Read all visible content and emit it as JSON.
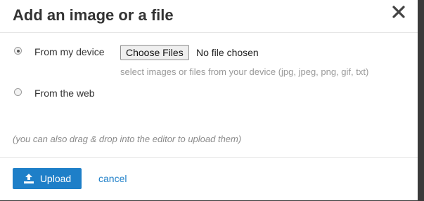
{
  "dialog": {
    "title": "Add an image or a file",
    "close_icon": "close-icon"
  },
  "source": {
    "device_label": "From my device",
    "device_selected": true,
    "web_label": "From the web",
    "web_selected": false
  },
  "file_input": {
    "button_label": "Choose Files",
    "status": "No file chosen",
    "hint": "select images or files from your device (jpg, jpeg, png, gif, txt)"
  },
  "dragdrop_note": "(you can also drag & drop into the editor to upload them)",
  "footer": {
    "upload_label": "Upload",
    "upload_icon": "upload-icon",
    "cancel_label": "cancel"
  },
  "colors": {
    "accent": "#1e7fc8",
    "title": "#333333",
    "hint": "#999999"
  }
}
